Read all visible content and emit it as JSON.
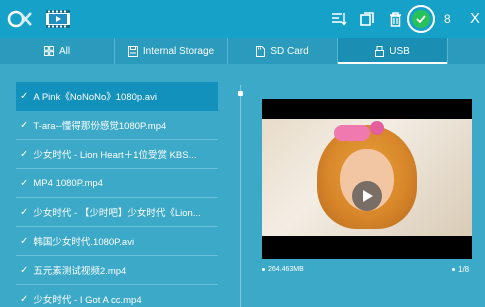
{
  "toolbar": {
    "selected_count": "8",
    "close_label": "X"
  },
  "tabs": [
    {
      "label": "All",
      "icon": "grid-icon"
    },
    {
      "label": "Internal Storage",
      "icon": "storage-icon"
    },
    {
      "label": "SD Card",
      "icon": "sd-card-icon"
    },
    {
      "label": "USB",
      "icon": "usb-icon"
    }
  ],
  "files": [
    {
      "name": "A Pink《NoNoNo》1080p.avi",
      "selected": true
    },
    {
      "name": "T-ara--懂得那份感觉1080P.mp4"
    },
    {
      "name": "少女时代 - Lion Heart＋1位受赏 KBS..."
    },
    {
      "name": "MP4 1080P.mp4"
    },
    {
      "name": "少女时代 - 【少时吧】少女时代《Lion..."
    },
    {
      "name": "韩国少女时代.1080P.avi"
    },
    {
      "name": "五元素测试视频2.mp4"
    },
    {
      "name": "少女时代 - I Got A cc.mp4"
    }
  ],
  "preview": {
    "file_size": "264.463MB",
    "page": "1/8"
  },
  "colors": {
    "background": "#3ba9c7",
    "topbar": "#16a1c9",
    "selected_row": "#1391bd",
    "check_green": "#27c25a"
  }
}
